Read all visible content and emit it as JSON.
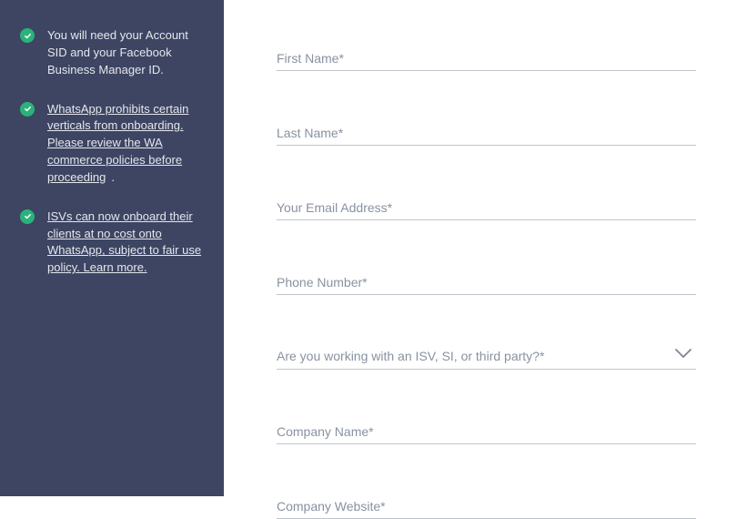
{
  "sidebar": {
    "items": [
      {
        "text": "You will need your Account SID and your Facebook Business Manager ID.",
        "underlined": false,
        "trailingDot": false
      },
      {
        "text": "WhatsApp prohibits certain verticals from onboarding. Please review the WA commerce policies before proceeding",
        "underlined": true,
        "trailingDot": true
      },
      {
        "text": "ISVs can now onboard their clients at no cost onto WhatsApp, subject to fair use policy. Learn more.",
        "underlined": true,
        "trailingDot": false
      }
    ]
  },
  "form": {
    "fields": [
      {
        "name": "first-name",
        "label": "First Name*",
        "type": "text"
      },
      {
        "name": "last-name",
        "label": "Last Name*",
        "type": "text"
      },
      {
        "name": "email",
        "label": "Your Email Address*",
        "type": "text"
      },
      {
        "name": "phone",
        "label": "Phone Number*",
        "type": "text"
      },
      {
        "name": "isv-select",
        "label": "Are you working with an ISV, SI, or third party?*",
        "type": "select"
      },
      {
        "name": "company-name",
        "label": "Company Name*",
        "type": "text"
      },
      {
        "name": "company-website",
        "label": "Company Website*",
        "type": "text"
      }
    ]
  }
}
